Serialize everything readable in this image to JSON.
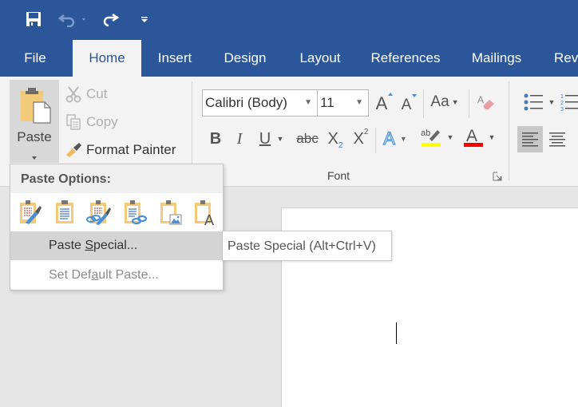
{
  "colors": {
    "brand": "#2b579a",
    "highlight": "#ffff00",
    "font_color": "#ff0000"
  },
  "qat": {
    "save_icon": "save-icon",
    "undo_icon": "undo-icon",
    "redo_icon": "redo-icon",
    "customize_icon": "customize-qat-icon"
  },
  "tabs": [
    {
      "label": "File",
      "active": false
    },
    {
      "label": "Home",
      "active": true
    },
    {
      "label": "Insert",
      "active": false
    },
    {
      "label": "Design",
      "active": false
    },
    {
      "label": "Layout",
      "active": false
    },
    {
      "label": "References",
      "active": false
    },
    {
      "label": "Mailings",
      "active": false
    },
    {
      "label": "Revi",
      "active": false
    }
  ],
  "clipboard": {
    "paste_label": "Paste",
    "cut_label": "Cut",
    "copy_label": "Copy",
    "format_painter_label": "Format Painter"
  },
  "font": {
    "font_name": "Calibri (Body)",
    "font_size": "11",
    "change_case_label": "Aa",
    "bold_label": "B",
    "italic_label": "I",
    "underline_label": "U",
    "strike_label": "abc",
    "subscript_label": "X",
    "subscript_sub": "2",
    "superscript_label": "X",
    "superscript_sup": "2",
    "text_effects_label": "A",
    "highlight_label": "ab",
    "font_color_label": "A",
    "grow_label": "A",
    "shrink_label": "A",
    "group_label": "Font"
  },
  "paste_menu": {
    "header": "Paste Options:",
    "options": [
      "keep-source-formatting-icon",
      "merge-formatting-icon",
      "link-keep-source-icon",
      "link-merge-icon",
      "paste-picture-icon",
      "keep-text-only-icon"
    ],
    "paste_special_pre": "Paste ",
    "paste_special_ul": "S",
    "paste_special_post": "pecial...",
    "set_default_pre": "Set Def",
    "set_default_ul": "a",
    "set_default_post": "ult Paste..."
  },
  "tooltip": {
    "text": "Paste Special (Alt+Ctrl+V)"
  }
}
